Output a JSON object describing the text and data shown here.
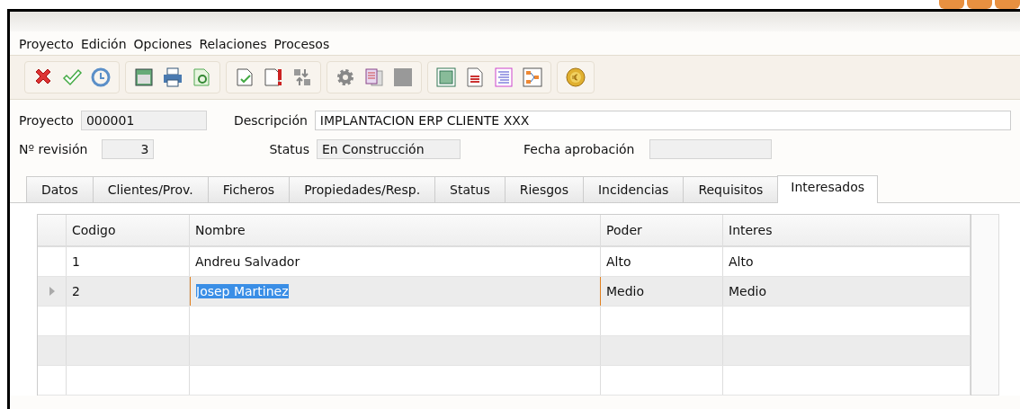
{
  "menu": [
    {
      "label": "Proyecto"
    },
    {
      "label": "Edición"
    },
    {
      "label": "Opciones"
    },
    {
      "label": "Relaciones"
    },
    {
      "label": "Procesos"
    }
  ],
  "header": {
    "proyecto_label": "Proyecto",
    "proyecto": "000001",
    "descripcion_label": "Descripción",
    "descripcion": "IMPLANTACION ERP CLIENTE XXX",
    "revision_label": "Nº revisión",
    "revision": "3",
    "status_label": "Status",
    "status": "En Construcción",
    "fecha_label": "Fecha aprobación"
  },
  "tabs": [
    {
      "label": "Datos",
      "selected": false
    },
    {
      "label": "Clientes/Prov.",
      "selected": false
    },
    {
      "label": "Ficheros",
      "selected": false
    },
    {
      "label": "Propiedades/Resp.",
      "selected": false
    },
    {
      "label": "Status",
      "selected": false
    },
    {
      "label": "Riesgos",
      "selected": false
    },
    {
      "label": "Incidencias",
      "selected": false
    },
    {
      "label": "Requisitos",
      "selected": false
    },
    {
      "label": "Interesados",
      "selected": true
    }
  ],
  "table": {
    "columns": [
      "Codigo",
      "Nombre",
      "Poder",
      "Interes"
    ],
    "rows": [
      {
        "cells": [
          "1",
          "Andreu Salvador",
          "Alto",
          "Alto"
        ],
        "selected": false
      },
      {
        "cells": [
          "2",
          "Josep Martinez",
          "Medio",
          "Medio"
        ],
        "selected": true
      }
    ]
  }
}
